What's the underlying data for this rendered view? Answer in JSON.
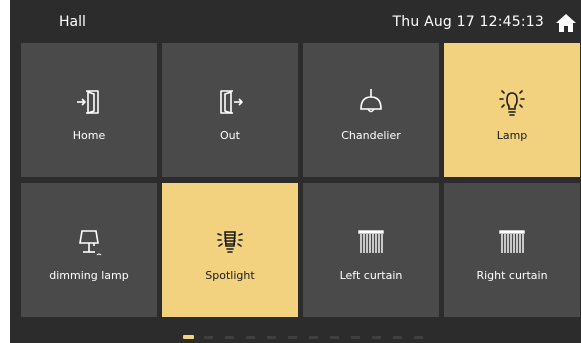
{
  "header": {
    "room": "Hall",
    "datetime": "Thu Aug 17  12:45:13"
  },
  "tiles": [
    {
      "label": "Home",
      "icon": "enter-door-icon",
      "active": false
    },
    {
      "label": "Out",
      "icon": "exit-door-icon",
      "active": false
    },
    {
      "label": "Chandelier",
      "icon": "chandelier-icon",
      "active": false
    },
    {
      "label": "Lamp",
      "icon": "bulb-icon",
      "active": true
    },
    {
      "label": "dimming lamp",
      "icon": "table-lamp-icon",
      "active": false
    },
    {
      "label": "Spotlight",
      "icon": "spotlight-icon",
      "active": true
    },
    {
      "label": "Left curtain",
      "icon": "curtain-icon",
      "active": false
    },
    {
      "label": "Right curtain",
      "icon": "curtain-icon",
      "active": false
    }
  ],
  "pager": {
    "pages": 12,
    "current": 1
  },
  "colors": {
    "active_tile": "#f3d27f",
    "tile": "#4a4a4a",
    "background": "#2c2c2c"
  }
}
